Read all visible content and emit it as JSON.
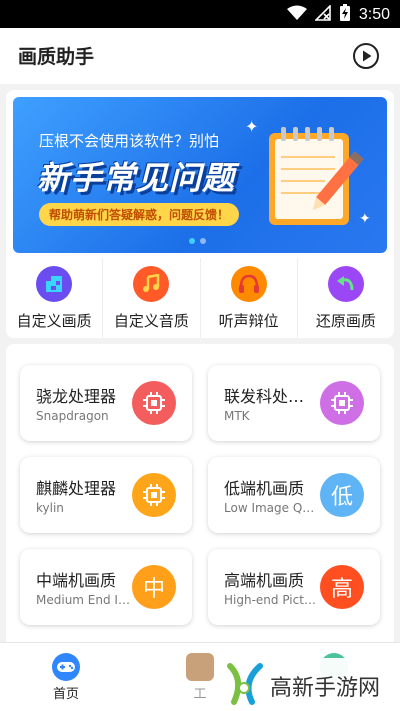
{
  "status_bar": {
    "time": "3:50",
    "icons": [
      "wifi-icon",
      "no-signal-icon",
      "battery-charging-icon"
    ]
  },
  "app_bar": {
    "title": "画质助手",
    "action_icon": "play-circle-icon"
  },
  "banner": {
    "subtitle": "压根不会使用该软件？别怕",
    "headline": "新手常见问题",
    "pill": "帮助萌新们答疑解惑，问题反馈！",
    "page_count": 2,
    "active_page": 1
  },
  "quick_actions": [
    {
      "label": "自定义画质",
      "icon": "quality-grid-icon",
      "color": "#6a4cf0"
    },
    {
      "label": "自定义音质",
      "icon": "music-note-icon",
      "color": "#ff5a28"
    },
    {
      "label": "听声辩位",
      "icon": "headphones-icon",
      "color": "#ff8a00"
    },
    {
      "label": "还原画质",
      "icon": "undo-arrow-icon",
      "color": "#9b47f5"
    }
  ],
  "tiles": [
    {
      "title": "骁龙处理器",
      "subtitle": "Snapdragon",
      "icon": "chip-icon",
      "icon_text": "",
      "color": "#f45d5d"
    },
    {
      "title": "联发科处理器",
      "subtitle": "MTK",
      "icon": "chip-icon",
      "icon_text": "",
      "color": "#cf6fe6"
    },
    {
      "title": "麒麟处理器",
      "subtitle": "kylin",
      "icon": "chip-icon",
      "icon_text": "",
      "color": "#ffa51a"
    },
    {
      "title": "低端机画质",
      "subtitle": "Low Image Quality",
      "icon": "low-text-icon",
      "icon_text": "低",
      "color": "#5fb4f5"
    },
    {
      "title": "中端机画质",
      "subtitle": "Medium End Image Quality",
      "icon": "mid-text-icon",
      "icon_text": "中",
      "color": "#ff9f1a"
    },
    {
      "title": "高端机画质",
      "subtitle": "High-end Picture Quality",
      "icon": "high-text-icon",
      "icon_text": "高",
      "color": "#ff4e1f"
    }
  ],
  "bottom_nav": [
    {
      "label": "首页",
      "icon": "gamepad-icon",
      "active": true,
      "color": "#2f86ff"
    },
    {
      "label": "工",
      "icon": "toolbox-icon",
      "active": false,
      "color": "#b07a4a"
    },
    {
      "label": "",
      "icon": "settings-icon",
      "active": false,
      "color": "#4cc39a"
    }
  ],
  "watermark": {
    "text": "高新手游网",
    "logo": "gaoxin-logo-icon"
  }
}
